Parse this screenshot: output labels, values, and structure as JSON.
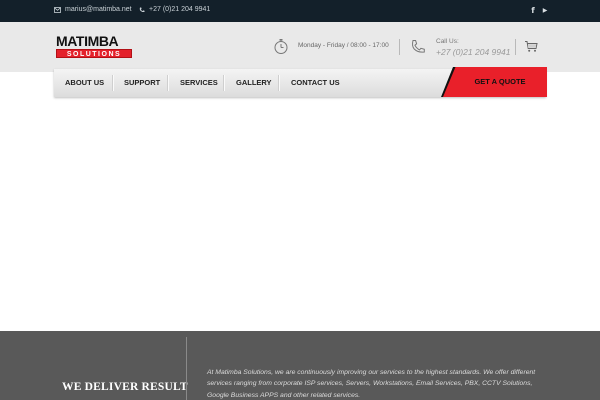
{
  "topbar": {
    "email": "marius@matimba.net",
    "phone": "+27 (0)21 204 9941",
    "social": [
      {
        "icon": "facebook-icon",
        "glyph": "f"
      },
      {
        "icon": "youtube-icon",
        "glyph": "▶"
      }
    ]
  },
  "header": {
    "logo_word": "MATIMBA",
    "logo_tag": "SOLUTIONS",
    "hours": "Monday - Friday / 08:00 - 17:00",
    "call_label": "Call Us:",
    "call_number": "+27 (0)21 204 9941"
  },
  "nav": {
    "items": [
      "ABOUT US",
      "SUPPORT",
      "SERVICES",
      "GALLERY",
      "CONTACT US"
    ],
    "cta": "GET A QUOTE"
  },
  "footer": {
    "headline_line1": "WE DELIVER RESULT",
    "headline_line2": "",
    "blurb": "At Matimba Solutions, we are continuously improving our services to the highest standards. We offer different services ranging from corporate ISP services, Servers, Workstations, Email Services, PBX, CCTV Solutions, Google Business APPS and other related services."
  },
  "colors": {
    "topbar": "#13202a",
    "header": "#e9e9e9",
    "accent": "#e9202a",
    "footer": "#595959"
  }
}
